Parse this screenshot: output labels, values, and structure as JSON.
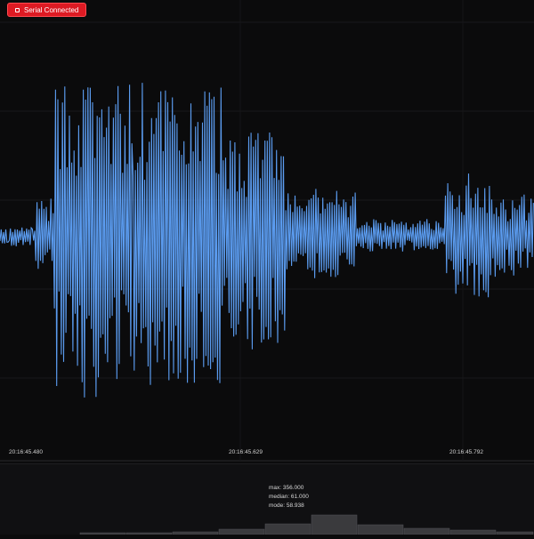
{
  "status": {
    "label": "Serial Connected",
    "color": "#dd1a23"
  },
  "chart_data": {
    "type": "line",
    "x_ticks": [
      "20:16:45.480",
      "20:16:45.629",
      "20:16:45.792"
    ],
    "series_color": "#5b9cf0",
    "grid": true
  },
  "stats": {
    "max": "max: 356.000",
    "median": "median: 61.000",
    "mode": "mode: 58.938"
  },
  "histogram": {
    "color": "#3a3a3d"
  }
}
